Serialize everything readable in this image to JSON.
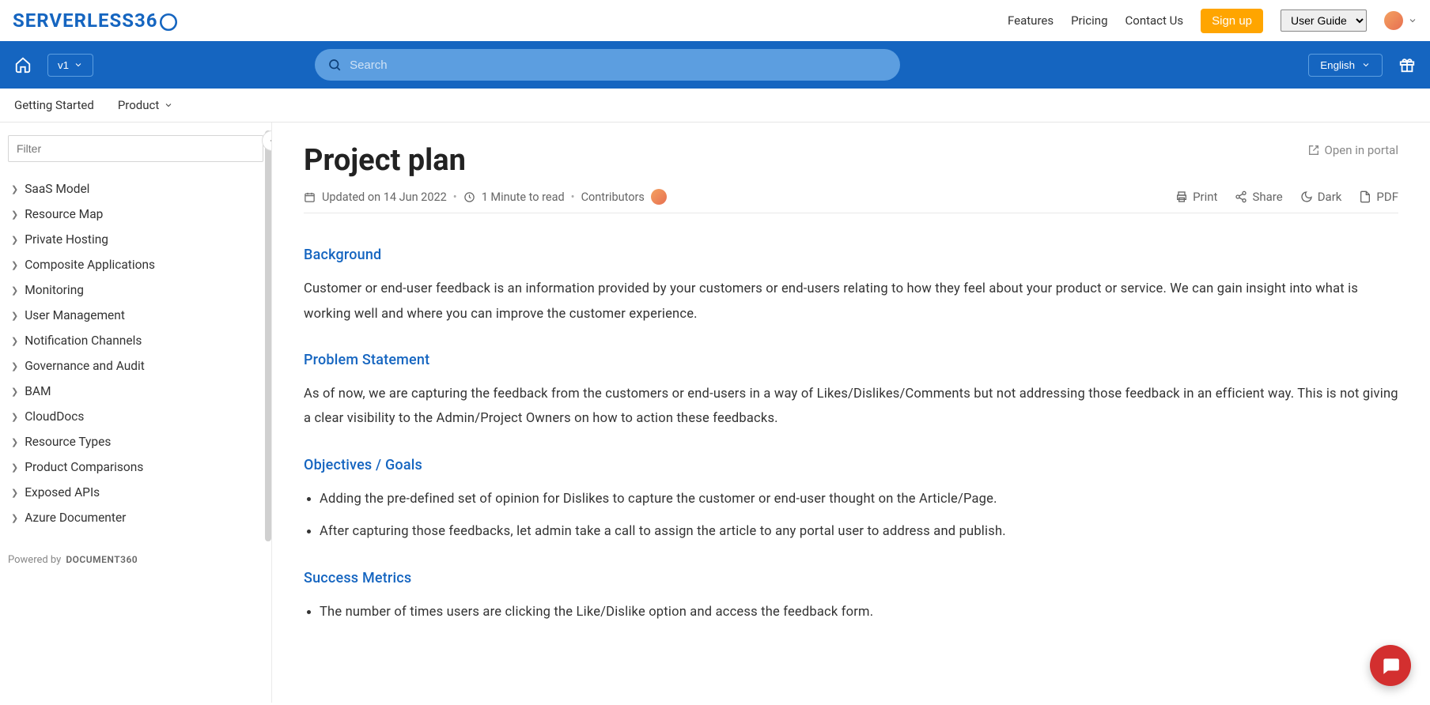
{
  "topnav": {
    "logo_text": "SERVERLESS36",
    "links": {
      "features": "Features",
      "pricing": "Pricing",
      "contact": "Contact Us"
    },
    "signup": "Sign up",
    "user_guide": "User Guide"
  },
  "bluebar": {
    "version": "v1",
    "search_placeholder": "Search",
    "language": "English"
  },
  "subnav": {
    "getting_started": "Getting Started",
    "product": "Product"
  },
  "sidebar": {
    "filter_placeholder": "Filter",
    "items": [
      "SaaS Model",
      "Resource Map",
      "Private Hosting",
      "Composite Applications",
      "Monitoring",
      "User Management",
      "Notification Channels",
      "Governance and Audit",
      "BAM",
      "CloudDocs",
      "Resource Types",
      "Product Comparisons",
      "Exposed APIs",
      "Azure Documenter"
    ],
    "powered_by": "Powered by",
    "powered_brand": "DOCUMENT360"
  },
  "article": {
    "title": "Project plan",
    "open_portal": "Open in portal",
    "updated_label": "Updated on 14 Jun 2022",
    "read_time": "1 Minute to read",
    "contributors_label": "Contributors",
    "actions": {
      "print": "Print",
      "share": "Share",
      "dark": "Dark",
      "pdf": "PDF"
    },
    "sections": {
      "background_h": "Background",
      "background_p": "Customer or end-user feedback is an information provided by your customers or end-users relating to how they feel about your product or service. We can gain insight into what is working well and where you can improve the customer experience.",
      "problem_h": "Problem Statement",
      "problem_p": "As of now, we are capturing the feedback from the customers or end-users in a way of Likes/Dislikes/Comments but not addressing those feedback in an efficient way. This is not giving a clear visibility to the Admin/Project Owners on how to action these feedbacks.",
      "objectives_h": "Objectives / Goals",
      "objectives_items": [
        "Adding the pre-defined set of opinion for Dislikes to capture the customer or end-user thought on the Article/Page.",
        "After capturing those feedbacks, let admin take a call to assign the article to any portal user to address and publish."
      ],
      "success_h": "Success Metrics",
      "success_items": [
        "The number of times users are clicking the Like/Dislike option and access the feedback form."
      ]
    }
  }
}
